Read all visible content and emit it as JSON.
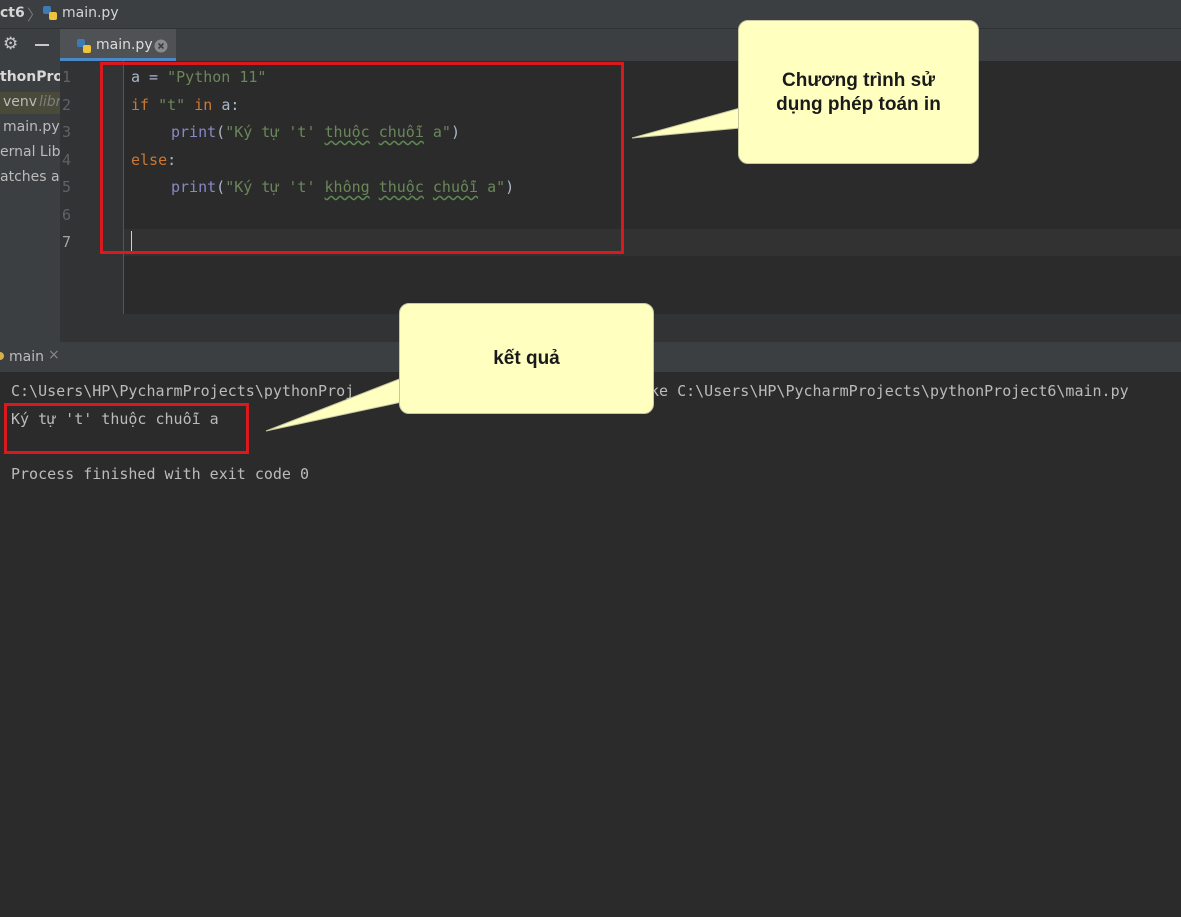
{
  "navbar": {
    "project_crumb": "ct6",
    "file_crumb": "main.py"
  },
  "editor_tab": {
    "label": "main.py"
  },
  "project_tree": {
    "root": "thonProje",
    "venv": "venv",
    "venv_note": "libr",
    "main": "main.py",
    "external": "ernal Libr",
    "scratches": "atches ar"
  },
  "line_numbers": [
    "1",
    "2",
    "3",
    "4",
    "5",
    "6",
    "7"
  ],
  "code": {
    "l1_a": "a = ",
    "l1_s": "\"Python 11\"",
    "l2_if": "if ",
    "l2_s": "\"t\"",
    "l2_in": " in ",
    "l2_rest": "a:",
    "l3_fn": "print",
    "l3_p1": "(",
    "l3_s1": "\"Ký tự 't' ",
    "l3_w1": "thuộc",
    "l3_sp": " ",
    "l3_w2": "chuỗi",
    "l3_s2": " a\"",
    "l3_p2": ")",
    "l4_else": "else",
    "l4_colon": ":",
    "l5_fn": "print",
    "l5_p1": "(",
    "l5_s1": "\"Ký tự 't' ",
    "l5_w1": "không",
    "l5_sp1": " ",
    "l5_w2": "thuộc",
    "l5_sp2": " ",
    "l5_w3": "chuỗi",
    "l5_s2": " a\"",
    "l5_p2": ")"
  },
  "run_panel": {
    "tab_label": "main",
    "cmd_left": "C:\\Users\\HP\\PycharmProjects\\pythonProj",
    "cmd_right": "ke C:\\Users\\HP\\PycharmProjects\\pythonProject6\\main.py",
    "output": "Ký tự 't' thuộc chuỗi a",
    "exit": "Process finished with exit code 0"
  },
  "callouts": {
    "top_line1": "Chương trình sử",
    "top_line2": "dụng phép toán in",
    "bottom": "kết quả"
  },
  "colors": {
    "annotation_red": "#d9191c",
    "callout_bg": "#ffffc0",
    "keyword": "#cc7832",
    "string": "#6a8759"
  }
}
